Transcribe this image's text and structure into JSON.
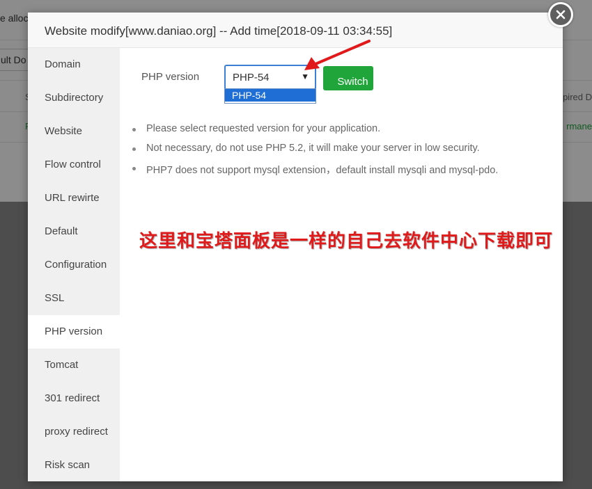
{
  "background": {
    "row1_text": "e alloc",
    "select_text": "ult Do",
    "header_left": "S",
    "header_right": "pired D",
    "cell_left": "F",
    "cell_right": "rmane"
  },
  "dialog": {
    "title": "Website modify[www.daniao.org] -- Add time[2018-09-11 03:34:55]"
  },
  "sidebar": {
    "items": [
      {
        "label": "Domain"
      },
      {
        "label": "Subdirectory"
      },
      {
        "label": "Website"
      },
      {
        "label": "Flow control"
      },
      {
        "label": "URL rewirte"
      },
      {
        "label": "Default"
      },
      {
        "label": "Configuration"
      },
      {
        "label": "SSL"
      },
      {
        "label": "PHP version"
      },
      {
        "label": "Tomcat"
      },
      {
        "label": "301 redirect"
      },
      {
        "label": "proxy redirect"
      },
      {
        "label": "Risk scan"
      }
    ],
    "active_index": 8
  },
  "php": {
    "label": "PHP version",
    "selected": "PHP-54",
    "options": [
      "PHP-54"
    ],
    "switch_label": "Switch"
  },
  "tips": [
    "Please select requested version for your application.",
    "Not necessary, do not use PHP 5.2, it will make your server in low security.",
    "PHP7 does not support mysql extension，default install mysqli and mysql-pdo."
  ],
  "annotation": {
    "text": "这里和宝塔面板是一样的自己去软件中心下载即可",
    "color": "#e01a1a"
  },
  "colors": {
    "accent_green": "#20a53a",
    "select_border": "#3b7fd6",
    "option_highlight": "#1e6ed6"
  }
}
